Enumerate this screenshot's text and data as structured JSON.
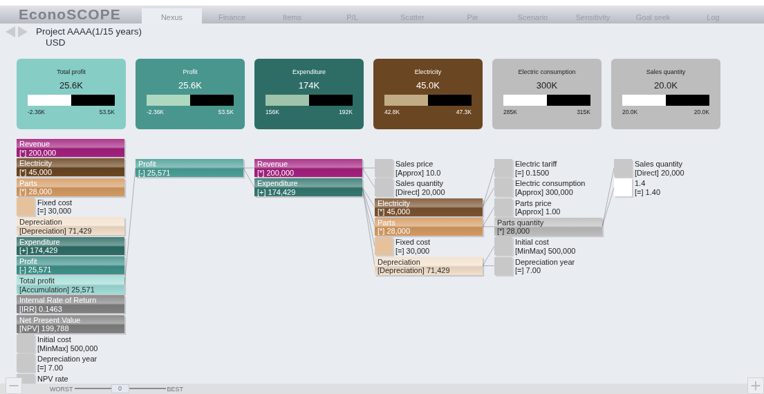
{
  "app": {
    "logo": "EconoSCOPE"
  },
  "tabs": [
    {
      "label": "Nexus",
      "selected": true
    },
    {
      "label": "Finance",
      "selected": false
    },
    {
      "label": "Items",
      "selected": false
    },
    {
      "label": "P/L",
      "selected": false
    },
    {
      "label": "Scatter",
      "selected": false
    },
    {
      "label": "Pie",
      "selected": false
    },
    {
      "label": "Scenario",
      "selected": false
    },
    {
      "label": "Sensitivity",
      "selected": false
    },
    {
      "label": "Goal seek",
      "selected": false
    },
    {
      "label": "Log",
      "selected": false
    }
  ],
  "project": {
    "title": "Project AAAA(1/15 years)",
    "currency": "USD"
  },
  "cards": [
    {
      "title": "Total profit",
      "value": "25.6K",
      "min": "-2.36K",
      "max": "53.5K",
      "level": 0.5,
      "color": "#86cdc6"
    },
    {
      "title": "Profit",
      "value": "25.6K",
      "min": "-2.36K",
      "max": "53.5K",
      "level": 0.5,
      "color": "#48968e"
    },
    {
      "title": "Expenditure",
      "value": "174K",
      "min": "156K",
      "max": "192K",
      "level": 0.5,
      "color": "#2e6d66"
    },
    {
      "title": "Electricity",
      "value": "45.0K",
      "min": "42.8K",
      "max": "47.3K",
      "level": 0.5,
      "color": "#6a4622"
    },
    {
      "title": "Electric consumption",
      "value": "300K",
      "min": "285K",
      "max": "315K",
      "level": 0.5,
      "color": "#bdbdbd"
    },
    {
      "title": "Sales quantity",
      "value": "20.0K",
      "min": "20.0K",
      "max": "20.0K",
      "level": 0.5,
      "color": "#bdbdbd"
    }
  ],
  "item_list": [
    {
      "kind": "bar",
      "label": "Revenue",
      "value": "[*] 200,000",
      "color": "#a3207e"
    },
    {
      "kind": "bar",
      "label": "Electricity",
      "value": "[*] 45,000",
      "color": "#6a4622"
    },
    {
      "kind": "bar",
      "label": "Parts",
      "value": "[*] 28,000",
      "color": "#d49a62"
    },
    {
      "kind": "square",
      "label": "Fixed cost",
      "value": "[=] 30,000",
      "color": "#e6c29c"
    },
    {
      "kind": "bar",
      "label": "Depreciation",
      "value": "[Depreciation] 71,429",
      "color": "#f3e0cb"
    },
    {
      "kind": "bar",
      "label": "Expenditure",
      "value": "[+] 174,429",
      "color": "#2e6d66"
    },
    {
      "kind": "bar",
      "label": "Profit",
      "value": "[-] 25,571",
      "color": "#3f918a"
    },
    {
      "kind": "bar",
      "label": "Total profit",
      "value": "[Accumulation] 25,571",
      "color": "#9fdcd6",
      "linked": true
    },
    {
      "kind": "bar",
      "label": "Internal Rate of Return",
      "value": "[IRR] 0.1463",
      "color": "#808080"
    },
    {
      "kind": "bar",
      "label": "Net Present Value",
      "value": "[NPV] 199,788",
      "color": "#808080"
    },
    {
      "kind": "square",
      "label": "Initial cost",
      "value": "[MinMax] 500,000",
      "color": "#c8c8c8"
    },
    {
      "kind": "square",
      "label": "Depreciation year",
      "value": "[=] 7.00",
      "color": "#c8c8c8"
    },
    {
      "kind": "square",
      "label": "NPV rate",
      "color": "#c8c8c8"
    }
  ],
  "tree": {
    "kind": "bar",
    "label": "Profit",
    "value": "[-] 25,571",
    "color": "#4a9f97",
    "children": [
      {
        "kind": "bar",
        "label": "Revenue",
        "value": "[*] 200,000",
        "color": "#a3207e",
        "children": [
          {
            "kind": "square",
            "label": "Sales price",
            "value": "[Approx] 10.0",
            "color": "#c8c8c8"
          },
          {
            "kind": "square",
            "label": "Sales quantity",
            "value": "[Direct] 20,000",
            "color": "#c8c8c8"
          }
        ]
      },
      {
        "kind": "bar",
        "label": "Expenditure",
        "value": "[+] 174,429",
        "color": "#357871",
        "children": [
          {
            "kind": "bar",
            "label": "Electricity",
            "value": "[*] 45,000",
            "color": "#7a5330",
            "children": [
              {
                "kind": "square",
                "label": "Electric tariff",
                "value": "[=] 0.1500",
                "color": "#c8c8c8"
              },
              {
                "kind": "square",
                "label": "Electric consumption",
                "value": "[Approx] 300,000",
                "color": "#c8c8c8"
              }
            ]
          },
          {
            "kind": "bar",
            "label": "Parts",
            "value": "[*] 28,000",
            "color": "#d49a62",
            "children": [
              {
                "kind": "square",
                "label": "Parts price",
                "value": "[Approx] 1.00",
                "color": "#c8c8c8"
              },
              {
                "kind": "bar",
                "label": "Parts quantity",
                "value": "[*] 28,000",
                "color": "#bdbdbd",
                "children": [
                  {
                    "kind": "square",
                    "label": "Sales quantity",
                    "value": "[Direct] 20,000",
                    "color": "#c8c8c8"
                  },
                  {
                    "kind": "square",
                    "label": "1.4",
                    "value": "[=] 1.40",
                    "color": "#ffffff"
                  }
                ]
              }
            ]
          },
          {
            "kind": "square",
            "label": "Fixed cost",
            "value": "[=] 30,000",
            "color": "#e6c29c"
          },
          {
            "kind": "bar",
            "label": "Depreciation",
            "value": "[Depreciation] 71,429",
            "color": "#f3e0cb",
            "children": [
              {
                "kind": "square",
                "label": "Initial cost",
                "value": "[MinMax] 500,000",
                "color": "#c8c8c8"
              },
              {
                "kind": "square",
                "label": "Depreciation year",
                "value": "[=] 7.00",
                "color": "#c8c8c8"
              }
            ]
          }
        ]
      }
    ]
  },
  "scenario_slider": {
    "worst_label": "WORST",
    "value": "0",
    "best_label": "BEST",
    "level": 0.5
  }
}
